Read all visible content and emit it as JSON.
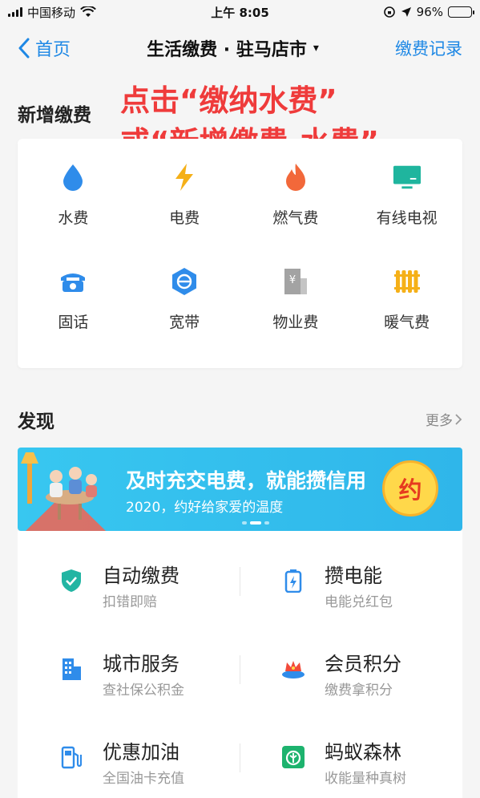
{
  "status_bar": {
    "carrier": "中国移动",
    "time": "上午 8:05",
    "battery": "96%",
    "battery_level": 0.96
  },
  "nav": {
    "back_label": "首页",
    "title": "生活缴费 · 驻马店市",
    "caret": "▾",
    "right_label": "缴费记录"
  },
  "annotation": {
    "line1": "点击“缴纳水费”",
    "line2": "或“新增缴费-水费”"
  },
  "add_section": {
    "title": "新增缴费",
    "items": [
      {
        "label": "水费",
        "icon": "water-drop-icon"
      },
      {
        "label": "电费",
        "icon": "lightning-icon"
      },
      {
        "label": "燃气费",
        "icon": "flame-icon"
      },
      {
        "label": "有线电视",
        "icon": "tv-icon"
      },
      {
        "label": "固话",
        "icon": "telephone-icon"
      },
      {
        "label": "宽带",
        "icon": "broadband-icon"
      },
      {
        "label": "物业费",
        "icon": "building-yen-icon"
      },
      {
        "label": "暖气费",
        "icon": "radiator-icon"
      }
    ]
  },
  "discover": {
    "title": "发现",
    "more_label": "更多",
    "banner": {
      "title": "及时充交电费，就能攒信用",
      "subtitle": "2020，约好给家爱的温度",
      "badge": "约"
    },
    "services": [
      {
        "name": "自动缴费",
        "desc": "扣错即赔",
        "icon": "shield-check-icon"
      },
      {
        "name": "攒电能",
        "desc": "电能兑红包",
        "icon": "battery-icon"
      },
      {
        "name": "城市服务",
        "desc": "查社保公积金",
        "icon": "city-building-icon"
      },
      {
        "name": "会员积分",
        "desc": "缴费拿积分",
        "icon": "member-crown-icon"
      },
      {
        "name": "优惠加油",
        "desc": "全国油卡充值",
        "icon": "gas-pump-icon"
      },
      {
        "name": "蚂蚁森林",
        "desc": "收能量种真树",
        "icon": "ant-forest-icon"
      }
    ]
  },
  "colors": {
    "accent": "#1e88e5",
    "annotation": "#ef3b3b",
    "banner": "#38c7f0"
  }
}
